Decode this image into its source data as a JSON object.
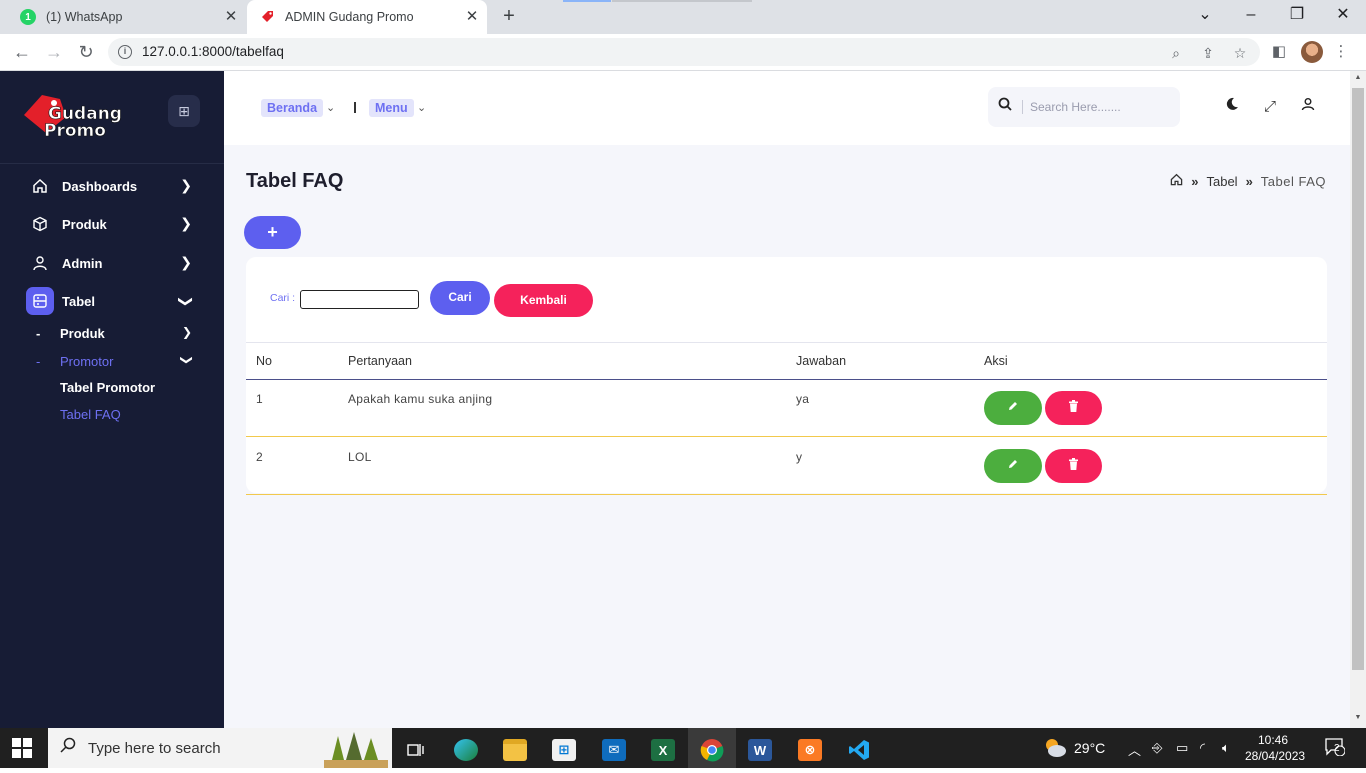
{
  "browser": {
    "tabs": [
      {
        "title": "(1) WhatsApp",
        "favicon_badge": "1"
      },
      {
        "title": "ADMIN Gudang Promo"
      }
    ],
    "url": "127.0.0.1:8000/tabelfaq"
  },
  "sidebar": {
    "logo_line1": "Gudang",
    "logo_line2": "Promo",
    "items": [
      {
        "label": "Dashboards",
        "icon": "home-icon"
      },
      {
        "label": "Produk",
        "icon": "box-icon"
      },
      {
        "label": "Admin",
        "icon": "user-icon"
      },
      {
        "label": "Tabel",
        "icon": "table-icon"
      }
    ],
    "sub_items": [
      {
        "label": "Produk"
      },
      {
        "label": "Promotor"
      }
    ],
    "leaves": [
      {
        "label": "Tabel Promotor"
      },
      {
        "label": "Tabel FAQ"
      }
    ]
  },
  "header": {
    "beranda": "Beranda",
    "menu": "Menu",
    "search_placeholder": "Search Here......."
  },
  "main": {
    "title": "Tabel FAQ",
    "breadcrumb": {
      "section": "Tabel",
      "current": "Tabel FAQ"
    },
    "add_label": "+",
    "search_label": "Cari :",
    "search_button": "Cari",
    "back_button": "Kembali",
    "table": {
      "columns": [
        "No",
        "Pertanyaan",
        "Jawaban",
        "Aksi"
      ],
      "rows": [
        {
          "no": "1",
          "pertanyaan": "Apakah kamu suka anjing",
          "jawaban": "ya"
        },
        {
          "no": "2",
          "pertanyaan": "LOL",
          "jawaban": "y"
        }
      ]
    }
  },
  "taskbar": {
    "search_text": "Type here to search",
    "weather": "29°C",
    "time": "10:46",
    "date": "28/04/2023",
    "notifications": "2"
  },
  "colors": {
    "accent": "#5d5fef",
    "danger": "#f5225b",
    "success": "#4cae3e",
    "sidebar_bg": "#171c35"
  }
}
